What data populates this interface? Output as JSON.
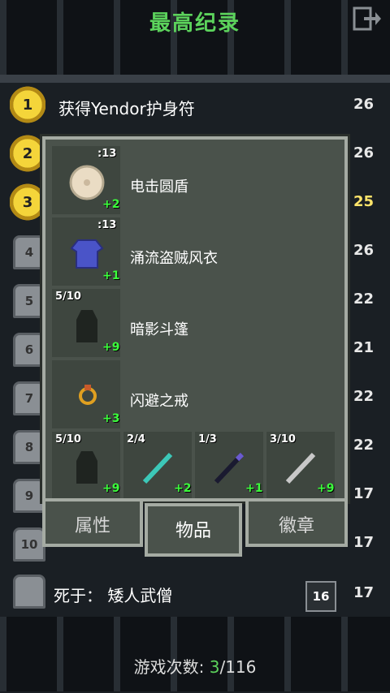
{
  "header": {
    "title": "最高纪录"
  },
  "rankings": [
    {
      "rank": "1",
      "text": "获得Yendor护身符",
      "score": "26",
      "style": "gold"
    },
    {
      "rank": "2",
      "text": "",
      "score": "26",
      "style": "gold"
    },
    {
      "rank": "3",
      "text": "",
      "score": "25",
      "style": "gold"
    },
    {
      "rank": "4",
      "text": "",
      "score": "26",
      "style": "stone"
    },
    {
      "rank": "5",
      "text": "",
      "score": "22",
      "style": "stone"
    },
    {
      "rank": "6",
      "text": "",
      "score": "21",
      "style": "stone"
    },
    {
      "rank": "7",
      "text": "",
      "score": "22",
      "style": "stone"
    },
    {
      "rank": "8",
      "text": "",
      "score": "22",
      "style": "stone"
    },
    {
      "rank": "9",
      "text": "",
      "score": "17",
      "style": "stone"
    },
    {
      "rank": "10",
      "text": "",
      "score": "17",
      "style": "stone"
    }
  ],
  "items": [
    {
      "count": ":13",
      "level": "+2",
      "name": "电击圆盾",
      "icon": "shield-icon"
    },
    {
      "count": ":13",
      "level": "+1",
      "name": "涌流盗贼风衣",
      "icon": "armor-icon"
    },
    {
      "count": "5/10",
      "level": "+9",
      "name": "暗影斗篷",
      "icon": "cloak-icon"
    },
    {
      "count": "",
      "level": "+3",
      "name": "闪避之戒",
      "icon": "ring-icon"
    }
  ],
  "quickslots": [
    {
      "count": "5/10",
      "level": "+9",
      "icon": "cloak-icon"
    },
    {
      "count": "2/4",
      "level": "+2",
      "icon": "wand-icon"
    },
    {
      "count": "1/3",
      "level": "+1",
      "icon": "wand-icon"
    },
    {
      "count": "3/10",
      "level": "+9",
      "icon": "staff-icon"
    }
  ],
  "tabs": [
    {
      "label": "属性",
      "active": false
    },
    {
      "label": "物品",
      "active": true
    },
    {
      "label": "徽章",
      "active": false
    }
  ],
  "death": {
    "text": "死于：  矮人武僧",
    "depth": "16",
    "score": "17"
  },
  "footer": {
    "label": "游戏次数:",
    "current": "3",
    "total": "/116"
  }
}
